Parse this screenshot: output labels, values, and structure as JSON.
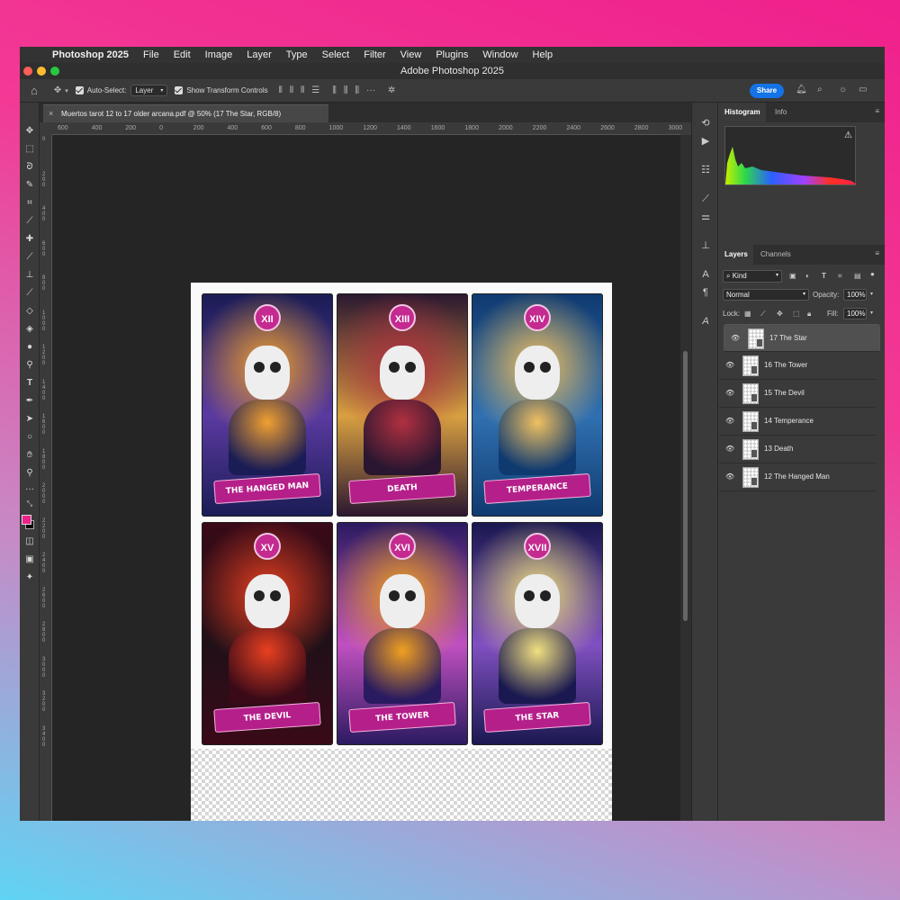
{
  "menubar": {
    "app": "Photoshop 2025",
    "items": [
      "File",
      "Edit",
      "Image",
      "Layer",
      "Type",
      "Select",
      "Filter",
      "View",
      "Plugins",
      "Window",
      "Help"
    ]
  },
  "window": {
    "title": "Adobe Photoshop 2025"
  },
  "options": {
    "auto_select_label": "Auto-Select:",
    "auto_select_value": "Layer",
    "transform_label": "Show Transform Controls",
    "share_label": "Share"
  },
  "document": {
    "tab_title": "Muertos tarot 12 to 17 older arcana.pdf @ 50% (17 The Star, RGB/8)"
  },
  "ruler": {
    "h_labels": [
      "600",
      "400",
      "200",
      "0",
      "200",
      "400",
      "600",
      "800",
      "1000",
      "1200",
      "1400",
      "1600",
      "1800",
      "2000",
      "2200",
      "2400",
      "2600",
      "2800",
      "3000"
    ],
    "v_labels": [
      "0",
      "2\n0\n0",
      "4\n0\n0",
      "6\n0\n0",
      "8\n0\n0",
      "1\n0\n0\n0",
      "1\n2\n0\n0",
      "1\n4\n0\n0",
      "1\n6\n0\n0",
      "1\n8\n0\n0",
      "2\n0\n0\n0",
      "2\n2\n0\n0",
      "2\n4\n0\n0",
      "2\n6\n0\n0",
      "2\n8\n0\n0",
      "3\n0\n0\n0",
      "3\n2\n0\n0",
      "3\n4\n0\n0"
    ]
  },
  "cards": [
    {
      "numeral": "XII",
      "title": "THE HANGED MAN",
      "colors": [
        "#1a1c55",
        "#f0a030",
        "#5a3aa0"
      ]
    },
    {
      "numeral": "XIII",
      "title": "DEATH",
      "colors": [
        "#2a1630",
        "#b03040",
        "#d8a040"
      ]
    },
    {
      "numeral": "XIV",
      "title": "TEMPERANCE",
      "colors": [
        "#0f3a70",
        "#f0c060",
        "#3070b0"
      ]
    },
    {
      "numeral": "XV",
      "title": "THE DEVIL",
      "colors": [
        "#3a0a18",
        "#e84020",
        "#201018"
      ]
    },
    {
      "numeral": "XVI",
      "title": "THE TOWER",
      "colors": [
        "#2a1a60",
        "#f0a020",
        "#c050c0"
      ]
    },
    {
      "numeral": "XVII",
      "title": "THE STAR",
      "colors": [
        "#1a1850",
        "#f0e080",
        "#8050c0"
      ]
    }
  ],
  "panels": {
    "histogram_tab": "Histogram",
    "info_tab": "Info",
    "layers_tab": "Layers",
    "channels_tab": "Channels",
    "kind_filter": "Kind",
    "blend_mode": "Normal",
    "opacity_label": "Opacity:",
    "opacity_value": "100%",
    "lock_label": "Lock:",
    "fill_label": "Fill:",
    "fill_value": "100%",
    "layers": [
      "17 The Star",
      "16 The Tower",
      "15 The Devil",
      "14 Temperance",
      "13 Death",
      "12 The Hanged Man"
    ]
  }
}
